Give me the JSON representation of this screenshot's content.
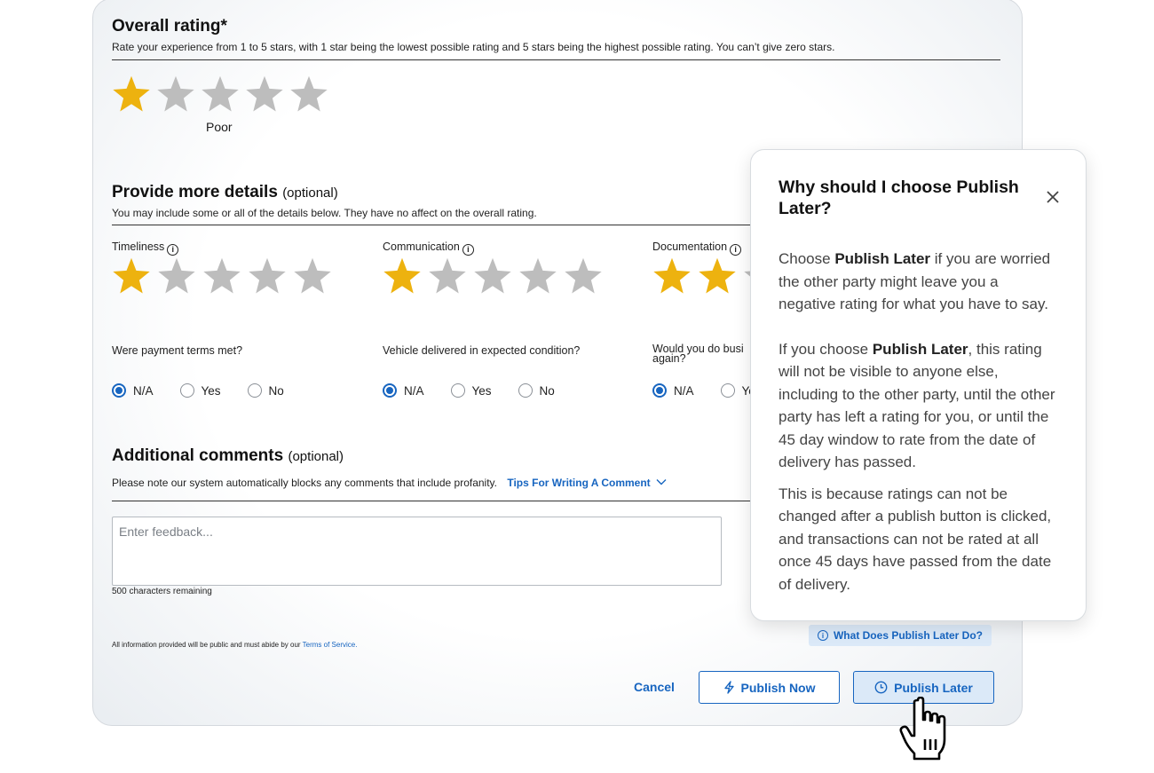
{
  "overall": {
    "title": "Overall rating*",
    "instructions": "Rate your experience from 1 to 5 stars, with 1 star being the lowest possible rating and 5 stars being the highest possible rating. You can’t give zero stars.",
    "rating": 1,
    "max": 5,
    "rating_label": "Poor"
  },
  "details": {
    "title": "Provide more details",
    "optional": "(optional)",
    "subtitle": "You may include some or all of the details below. They have no affect on the overall rating.",
    "categories": [
      {
        "label": "Timeliness",
        "rating": 1
      },
      {
        "label": "Communication",
        "rating": 1
      },
      {
        "label": "Documentation",
        "rating": 2
      }
    ],
    "questions": [
      {
        "label": "Were payment terms met?",
        "selected": "N/A"
      },
      {
        "label": "Vehicle delivered in expected condition?",
        "selected": "N/A"
      },
      {
        "label": "Would you do business again?",
        "label_line1": "Would you do busi",
        "label_line2": "again?",
        "selected": "N/A"
      }
    ],
    "options": [
      "N/A",
      "Yes",
      "No"
    ]
  },
  "comments": {
    "title": "Additional comments",
    "optional": "(optional)",
    "note": "Please note our system automatically blocks any comments that include profanity.",
    "tips_link": "Tips For Writing A Comment",
    "placeholder": "Enter feedback...",
    "remaining": "500 characters remaining"
  },
  "footer": {
    "disclaimer": "All information provided will be public and must abide by our",
    "tos_link": "Terms of Service.",
    "help_link": "What Does Publish Later Do?",
    "cancel": "Cancel",
    "publish_now": "Publish Now",
    "publish_later": "Publish Later"
  },
  "popover": {
    "title": "Why should I choose Publish Later?",
    "p1_pre": "Choose ",
    "p1_bold": "Publish Later",
    "p1_post": " if you are worried the other party might leave you a negative rating for what you have to say.",
    "p2_pre": "If you choose ",
    "p2_bold": "Publish Later",
    "p2_post": ", this rating will not be visible to anyone else, including to the other party, until the other party has left a rating for you, or until the 45 day window to rate from the date of delivery has passed.",
    "p3": "This is because ratings can not be changed after a publish button is clicked, and transactions can not be rated at all once 45 days have passed from the date of delivery."
  },
  "colors": {
    "star_filled": "#EDB20F",
    "star_empty": "#BDBDBD",
    "accent": "#1765C0"
  }
}
